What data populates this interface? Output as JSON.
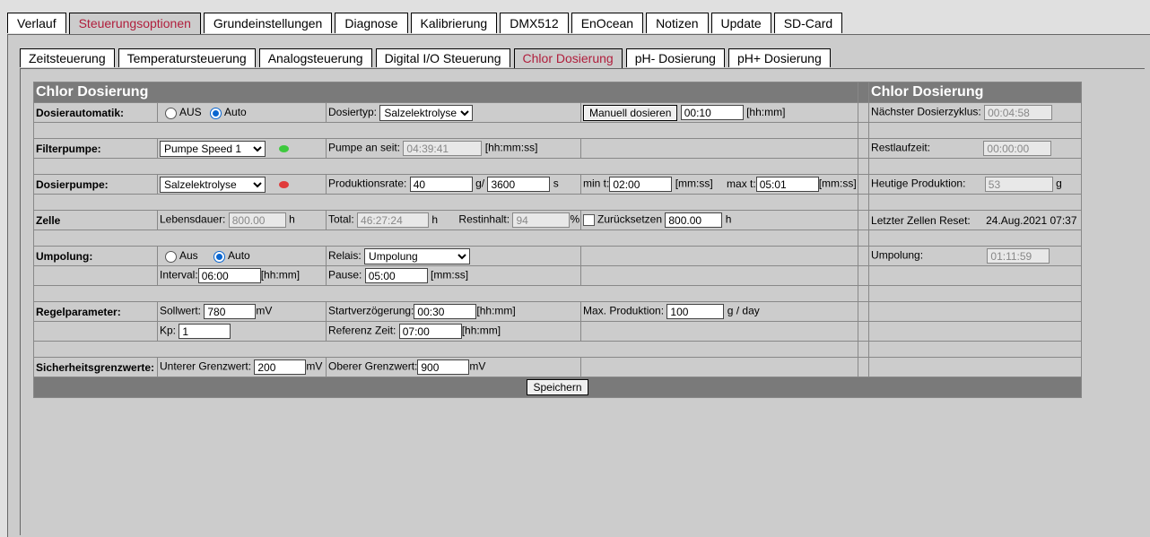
{
  "colors": {
    "active_tab_text": "#b01e3c",
    "header_bg": "#7a7a7a",
    "led_green": "#3ec93e",
    "led_red": "#e03a3a"
  },
  "main_tabs": [
    "Verlauf",
    "Steuerungsoptionen",
    "Grundeinstellungen",
    "Diagnose",
    "Kalibrierung",
    "DMX512",
    "EnOcean",
    "Notizen",
    "Update",
    "SD-Card"
  ],
  "sub_tabs": [
    "Zeitsteuerung",
    "Temperatursteuerung",
    "Analogsteuerung",
    "Digital I/O Steuerung",
    "Chlor Dosierung",
    "pH- Dosierung",
    "pH+ Dosierung"
  ],
  "header": {
    "left_title": "Chlor Dosierung",
    "right_title": "Chlor Dosierung"
  },
  "dosierautomatik": {
    "label": "Dosierautomatik:",
    "opt_aus": "AUS",
    "opt_auto": "Auto",
    "typ_label": "Dosiertyp:",
    "typ_value": "Salzelektrolyse",
    "manual_button": "Manuell dosieren",
    "manual_time": "00:10",
    "manual_unit": "[hh:mm]",
    "right_label": "Nächster Dosierzyklus:",
    "right_value": "00:04:58"
  },
  "filterpumpe": {
    "label": "Filterpumpe:",
    "select_value": "Pumpe Speed 1",
    "on_label": "Pumpe an seit:",
    "on_value": "04:39:41",
    "on_unit": "[hh:mm:ss]",
    "right_label": "Restlaufzeit:",
    "right_value": "00:00:00"
  },
  "dosierpumpe": {
    "label": "Dosierpumpe:",
    "select_value": "Salzelektrolyse",
    "rate_label": "Produktionsrate:",
    "rate_value": "40",
    "rate_sep": "g/",
    "rate_time": "3600",
    "rate_unit": "s",
    "min_label": "min t:",
    "min_value": "02:00",
    "min_unit": "[mm:ss]",
    "max_label": "max t:",
    "max_value": "05:01",
    "max_unit": "[mm:ss]",
    "right_label": "Heutige Produktion:",
    "right_value": "53",
    "right_unit": "g"
  },
  "zelle": {
    "label": "Zelle",
    "life_label": "Lebensdauer:",
    "life_value": "800.00",
    "life_unit": "h",
    "total_label": "Total:",
    "total_value": "46:27:24",
    "total_unit": "h",
    "rest_label": "Restinhalt:",
    "rest_value": "94",
    "rest_unit": "%",
    "reset_label": "Zurücksetzen",
    "reset_value": "800.00",
    "reset_unit": "h",
    "right_label": "Letzter Zellen Reset:",
    "right_value": "24.Aug.2021 07:37"
  },
  "umpolung": {
    "label": "Umpolung:",
    "opt_aus": "Aus",
    "opt_auto": "Auto",
    "relais_label": "Relais:",
    "relais_value": "Umpolung",
    "interval_label": "Interval:",
    "interval_value": "06:00",
    "interval_unit": "[hh:mm]",
    "pause_label": "Pause:",
    "pause_value": "05:00",
    "pause_unit": "[mm:ss]",
    "right_label": "Umpolung:",
    "right_value": "01:11:59"
  },
  "regel": {
    "label": "Regelparameter:",
    "soll_label": "Sollwert:",
    "soll_value": "780",
    "soll_unit": "mV",
    "start_label": "Startverzögerung:",
    "start_value": "00:30",
    "start_unit": "[hh:mm]",
    "maxprod_label": "Max. Produktion:",
    "maxprod_value": "100",
    "maxprod_unit": "g / day",
    "kp_label": "Kp:",
    "kp_value": "1",
    "ref_label": "Referenz Zeit:",
    "ref_value": "07:00",
    "ref_unit": "[hh:mm]"
  },
  "sicherheit": {
    "label": "Sicherheitsgrenzwerte:",
    "lower_label": "Unterer Grenzwert:",
    "lower_value": "200",
    "lower_unit": "mV",
    "upper_label": "Oberer Grenzwert:",
    "upper_value": "900",
    "upper_unit": "mV"
  },
  "save_button": "Speichern"
}
